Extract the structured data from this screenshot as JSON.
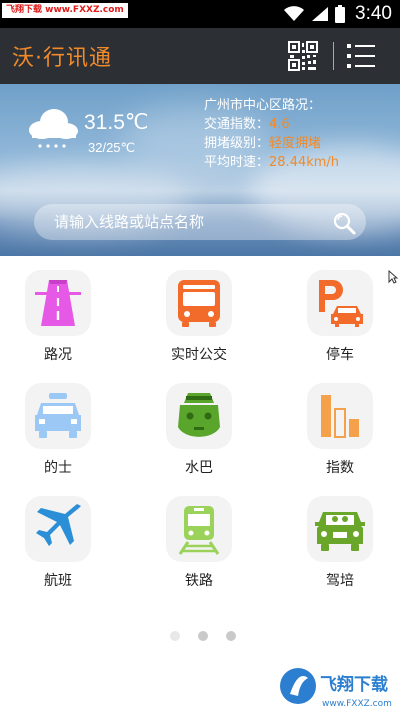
{
  "status_bar": {
    "watermark": "飞翔下载 www.FXXZ.com",
    "time": "3:40"
  },
  "header": {
    "title": "沃·行讯通"
  },
  "weather": {
    "current_temp": "31.5℃",
    "temp_range": "32/25℃"
  },
  "traffic": {
    "region_label": "广州市中心区路况：",
    "index_label": "交通指数：",
    "index_value": "4.6",
    "level_label": "拥堵级别：",
    "level_value": "轻度拥堵",
    "speed_label": "平均时速：",
    "speed_value": "28.44km/h"
  },
  "search": {
    "placeholder": "请输入线路或站点名称"
  },
  "tiles": [
    {
      "label": "路况",
      "icon": "road-icon"
    },
    {
      "label": "实时公交",
      "icon": "bus-icon"
    },
    {
      "label": "停车",
      "icon": "parking-icon"
    },
    {
      "label": "的士",
      "icon": "taxi-icon"
    },
    {
      "label": "水巴",
      "icon": "ferry-icon"
    },
    {
      "label": "指数",
      "icon": "bar-chart-icon"
    },
    {
      "label": "航班",
      "icon": "airplane-icon"
    },
    {
      "label": "铁路",
      "icon": "train-icon"
    },
    {
      "label": "驾培",
      "icon": "driving-school-icon"
    }
  ],
  "pager": {
    "pages": 3,
    "current": 1
  },
  "watermark_bottom": {
    "brand": "飞翔下载",
    "url": "www.FXXZ.com"
  },
  "colors": {
    "accent": "#f08a2a",
    "header_bg": "#2c2f34",
    "road": "#e659e6",
    "bus": "#f26b2b",
    "parking": "#f26b2b",
    "taxi": "#9cc8f5",
    "ferry": "#5aa52b",
    "chart": "#f5a04a",
    "airplane": "#2a8fd6",
    "train": "#9bd25a",
    "driving": "#6aa62a"
  }
}
